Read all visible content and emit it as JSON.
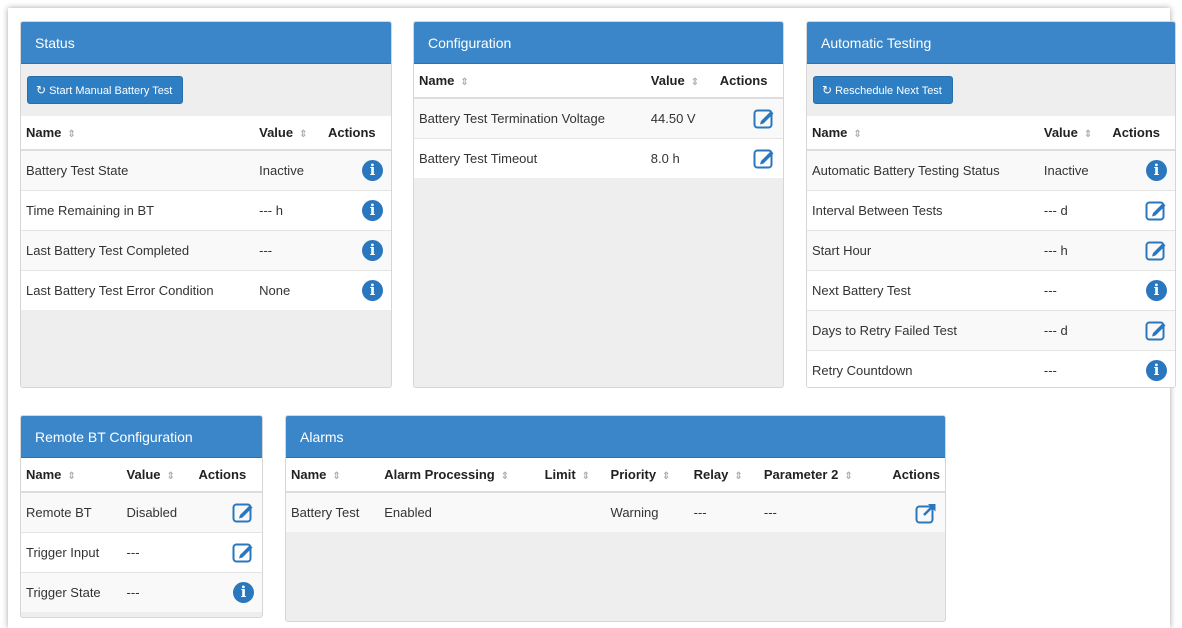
{
  "status": {
    "title": "Status",
    "button_label": "Start Manual Battery Test",
    "columns": {
      "name": "Name",
      "value": "Value",
      "actions": "Actions"
    },
    "rows": [
      {
        "name": "Battery Test State",
        "value": "Inactive",
        "action": "info"
      },
      {
        "name": "Time Remaining in BT",
        "value": "--- h",
        "action": "info"
      },
      {
        "name": "Last Battery Test Completed",
        "value": "---",
        "action": "info"
      },
      {
        "name": "Last Battery Test Error Condition",
        "value": "None",
        "action": "info"
      }
    ]
  },
  "configuration": {
    "title": "Configuration",
    "columns": {
      "name": "Name",
      "value": "Value",
      "actions": "Actions"
    },
    "rows": [
      {
        "name": "Battery Test Termination Voltage",
        "value": "44.50 V",
        "action": "edit"
      },
      {
        "name": "Battery Test Timeout",
        "value": "8.0 h",
        "action": "edit"
      }
    ]
  },
  "automatic_testing": {
    "title": "Automatic Testing",
    "button_label": "Reschedule Next Test",
    "columns": {
      "name": "Name",
      "value": "Value",
      "actions": "Actions"
    },
    "rows": [
      {
        "name": "Automatic Battery Testing Status",
        "value": "Inactive",
        "action": "info"
      },
      {
        "name": "Interval Between Tests",
        "value": "--- d",
        "action": "edit"
      },
      {
        "name": "Start Hour",
        "value": "--- h",
        "action": "edit"
      },
      {
        "name": "Next Battery Test",
        "value": "---",
        "action": "info"
      },
      {
        "name": "Days to Retry Failed Test",
        "value": "--- d",
        "action": "edit"
      },
      {
        "name": "Retry Countdown",
        "value": "---",
        "action": "info"
      }
    ]
  },
  "remote_bt": {
    "title": "Remote BT Configuration",
    "columns": {
      "name": "Name",
      "value": "Value",
      "actions": "Actions"
    },
    "rows": [
      {
        "name": "Remote BT",
        "value": "Disabled",
        "action": "edit"
      },
      {
        "name": "Trigger Input",
        "value": "---",
        "action": "edit"
      },
      {
        "name": "Trigger State",
        "value": "---",
        "action": "info"
      }
    ]
  },
  "alarms": {
    "title": "Alarms",
    "columns": {
      "name": "Name",
      "processing": "Alarm Processing",
      "limit": "Limit",
      "priority": "Priority",
      "relay": "Relay",
      "parameter2": "Parameter 2",
      "actions": "Actions"
    },
    "rows": [
      {
        "name": "Battery Test",
        "processing": "Enabled",
        "limit": "",
        "priority": "Warning",
        "relay": "---",
        "parameter2": "---",
        "action": "external"
      }
    ]
  },
  "colors": {
    "header": "#3a86c8",
    "button": "#2e7ec4",
    "icon": "#2a77bd"
  }
}
